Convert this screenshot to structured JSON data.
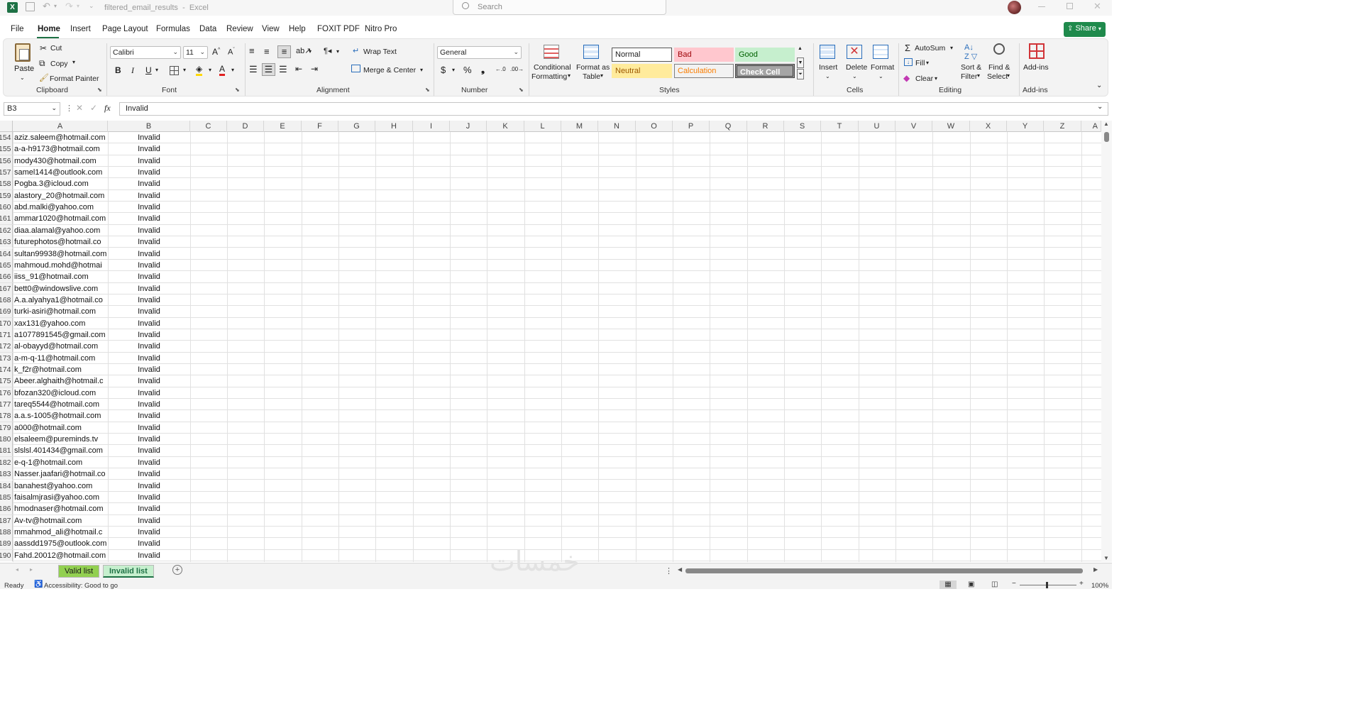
{
  "app": {
    "file_name": "filtered_email_results",
    "app_name": "Excel",
    "title_separator": "-"
  },
  "search": {
    "placeholder": "Search"
  },
  "menu": [
    "File",
    "Home",
    "Insert",
    "Page Layout",
    "Formulas",
    "Data",
    "Review",
    "View",
    "Help",
    "FOXIT PDF",
    "Nitro Pro"
  ],
  "share_label": "Share",
  "clipboard": {
    "paste": "Paste",
    "cut": "Cut",
    "copy": "Copy",
    "format_painter": "Format Painter",
    "group": "Clipboard"
  },
  "font": {
    "name": "Calibri",
    "size": "11",
    "group": "Font"
  },
  "alignment": {
    "wrap_text": "Wrap Text",
    "merge_center": "Merge & Center",
    "group": "Alignment"
  },
  "number": {
    "format": "General",
    "group": "Number"
  },
  "styles": {
    "conditional_formatting_1": "Conditional",
    "conditional_formatting_2": "Formatting",
    "format_as_table_1": "Format as",
    "format_as_table_2": "Table",
    "normal": "Normal",
    "bad": "Bad",
    "good": "Good",
    "neutral": "Neutral",
    "calculation": "Calculation",
    "check_cell": "Check Cell",
    "group": "Styles"
  },
  "cells": {
    "insert": "Insert",
    "delete": "Delete",
    "format": "Format",
    "group": "Cells"
  },
  "editing": {
    "autosum": "AutoSum",
    "fill": "Fill",
    "clear": "Clear",
    "sort_1": "Sort &",
    "sort_2": "Filter",
    "find_1": "Find &",
    "find_2": "Select",
    "group": "Editing"
  },
  "addins": {
    "label": "Add-ins",
    "group": "Add-ins"
  },
  "formula_bar": {
    "name_box": "B3",
    "fx": "fx",
    "value": "Invalid"
  },
  "columns": [
    "A",
    "B",
    "C",
    "D",
    "E",
    "F",
    "G",
    "H",
    "I",
    "J",
    "K",
    "L",
    "M",
    "N",
    "O",
    "P",
    "Q",
    "R",
    "S",
    "T",
    "U",
    "V",
    "W",
    "X",
    "Y",
    "Z",
    "A"
  ],
  "rows": [
    {
      "n": "154",
      "a": "aziz.saleem@hotmail.com",
      "b": "Invalid"
    },
    {
      "n": "155",
      "a": "a-a-h9173@hotmail.com",
      "b": "Invalid"
    },
    {
      "n": "156",
      "a": "mody430@hotmail.com",
      "b": "Invalid"
    },
    {
      "n": "157",
      "a": "samel1414@outlook.com",
      "b": "Invalid"
    },
    {
      "n": "158",
      "a": "Pogba.3@icloud.com",
      "b": "Invalid"
    },
    {
      "n": "159",
      "a": "alastory_20@hotmail.com",
      "b": "Invalid"
    },
    {
      "n": "160",
      "a": "abd.malki@yahoo.com",
      "b": "Invalid"
    },
    {
      "n": "161",
      "a": "ammar1020@hotmail.com",
      "b": "Invalid"
    },
    {
      "n": "162",
      "a": "diaa.alamal@yahoo.com",
      "b": "Invalid"
    },
    {
      "n": "163",
      "a": "futurephotos@hotmail.co",
      "b": "Invalid"
    },
    {
      "n": "164",
      "a": "sultan99938@hotmail.com",
      "b": "Invalid"
    },
    {
      "n": "165",
      "a": "mahmoud.mohd@hotmai",
      "b": "Invalid"
    },
    {
      "n": "166",
      "a": "iiss_91@hotmail.com",
      "b": "Invalid"
    },
    {
      "n": "167",
      "a": "bett0@windowslive.com",
      "b": "Invalid"
    },
    {
      "n": "168",
      "a": "A.a.alyahya1@hotmail.co",
      "b": "Invalid"
    },
    {
      "n": "169",
      "a": "turki-asiri@hotmail.com",
      "b": "Invalid"
    },
    {
      "n": "170",
      "a": "xax131@yahoo.com",
      "b": "Invalid"
    },
    {
      "n": "171",
      "a": "a1077891545@gmail.com",
      "b": "Invalid"
    },
    {
      "n": "172",
      "a": "al-obayyd@hotmail.com",
      "b": "Invalid"
    },
    {
      "n": "173",
      "a": "a-m-q-11@hotmail.com",
      "b": "Invalid"
    },
    {
      "n": "174",
      "a": "k_f2r@hotmail.com",
      "b": "Invalid"
    },
    {
      "n": "175",
      "a": "Abeer.alghaith@hotmail.c",
      "b": "Invalid"
    },
    {
      "n": "176",
      "a": "bfozan320@icloud.com",
      "b": "Invalid"
    },
    {
      "n": "177",
      "a": "tareq5544@hotmail.com",
      "b": "Invalid"
    },
    {
      "n": "178",
      "a": "a.a.s-1005@hotmail.com",
      "b": "Invalid"
    },
    {
      "n": "179",
      "a": "a000@hotmail.com",
      "b": "Invalid"
    },
    {
      "n": "180",
      "a": "elsaleem@pureminds.tv",
      "b": "Invalid"
    },
    {
      "n": "181",
      "a": "slslsl.401434@gmail.com",
      "b": "Invalid"
    },
    {
      "n": "182",
      "a": "e-q-1@hotmail.com",
      "b": "Invalid"
    },
    {
      "n": "183",
      "a": "Nasser.jaafari@hotmail.co",
      "b": "Invalid"
    },
    {
      "n": "184",
      "a": "banahest@yahoo.com",
      "b": "Invalid"
    },
    {
      "n": "185",
      "a": "faisalmjrasi@yahoo.com",
      "b": "Invalid"
    },
    {
      "n": "186",
      "a": "hmodnaser@hotmail.com",
      "b": "Invalid"
    },
    {
      "n": "187",
      "a": "Av-tv@hotmail.com",
      "b": "Invalid"
    },
    {
      "n": "188",
      "a": "mmahmod_ali@hotmail.c",
      "b": "Invalid"
    },
    {
      "n": "189",
      "a": "aassdd1975@outlook.com",
      "b": "Invalid"
    },
    {
      "n": "190",
      "a": "Fahd.20012@hotmail.com",
      "b": "Invalid"
    }
  ],
  "sheets": {
    "valid": "Valid list",
    "invalid": "Invalid list"
  },
  "status": {
    "ready": "Ready",
    "accessibility": "Accessibility: Good to go",
    "zoom": "100%"
  },
  "watermark": "خمسات",
  "colors": {
    "excel_green": "#1e7145",
    "share_green": "#1f8a4c",
    "active_tab": "#1e7145"
  }
}
